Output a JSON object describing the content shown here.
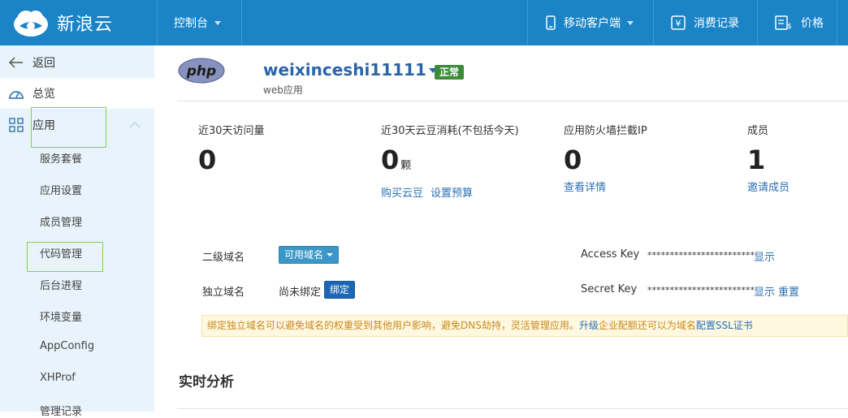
{
  "header": {
    "logo_text": "新浪云",
    "console": "控制台",
    "mobile_client": "移动客户端",
    "billing": "消费记录",
    "price": "价格"
  },
  "sidebar": {
    "back": "返回",
    "overview": "总览",
    "apps": "应用",
    "items": [
      "服务套餐",
      "应用设置",
      "成员管理",
      "代码管理",
      "后台进程",
      "环境变量",
      "AppConfig",
      "XHProf",
      "管理记录"
    ]
  },
  "app": {
    "logo_text": "php",
    "name": "weixinceshi11111",
    "type": "web应用",
    "status": "正常"
  },
  "stats": {
    "visits_label": "近30天访问量",
    "visits_value": "0",
    "beans_label": "近30天云豆消耗(不包括今天)",
    "beans_value": "0",
    "beans_unit": "颗",
    "buy_beans": "购买云豆",
    "set_budget": "设置预算",
    "firewall_label": "应用防火墙拦截IP",
    "firewall_value": "0",
    "view_details": "查看详情",
    "members_label": "成员",
    "members_value": "1",
    "invite_member": "邀请成员"
  },
  "domains": {
    "subdomain_label": "二级域名",
    "subdomain_button": "可用域名",
    "custom_label": "独立域名",
    "custom_value": "尚未绑定",
    "bind_button": "绑定"
  },
  "keys": {
    "access_label": "Access Key",
    "access_mask": "************************",
    "access_show": "显示",
    "secret_label": "Secret Key",
    "secret_mask": "************************",
    "secret_show": "显示",
    "secret_reset": "重置"
  },
  "notice": {
    "text1": "绑定独立域名可以避免域名的权重受到其他用户影响，避免DNS劫持，灵活管理应用。",
    "link1": "升级",
    "text2": "企业配额还可以为域名",
    "link2": "配置SSL证书"
  },
  "realtime_title": "实时分析"
}
